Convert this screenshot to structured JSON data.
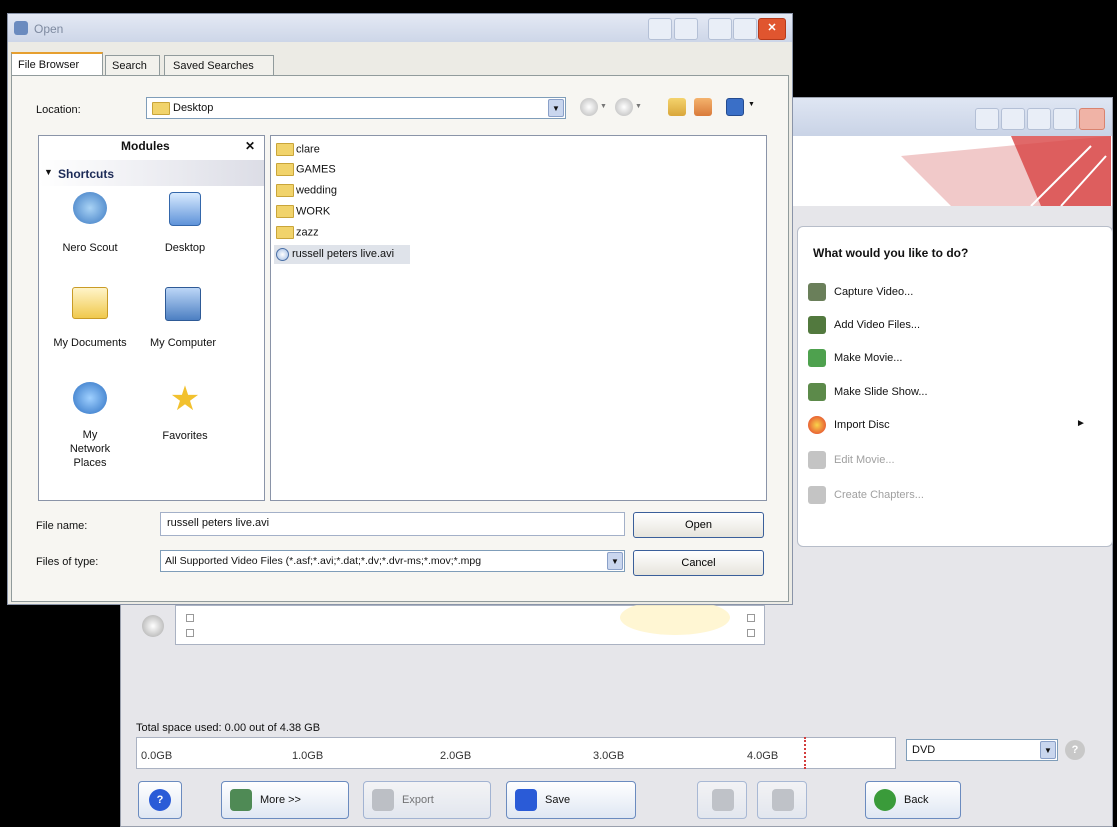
{
  "open_dialog": {
    "title": "Open",
    "tabs": [
      "File Browser",
      "Search",
      "Saved Searches"
    ],
    "location_label": "Location:",
    "location_value": "Desktop",
    "modules_title": "Modules",
    "shortcuts_label": "Shortcuts",
    "shortcuts": [
      {
        "label": "Nero Scout",
        "icon": "nero-scout-icon"
      },
      {
        "label": "Desktop",
        "icon": "desktop-icon"
      },
      {
        "label": "My Documents",
        "icon": "my-documents-icon"
      },
      {
        "label": "My Computer",
        "icon": "my-computer-icon"
      },
      {
        "label": "My Network Places",
        "icon": "network-places-icon"
      },
      {
        "label": "Favorites",
        "icon": "favorites-icon"
      }
    ],
    "files": [
      {
        "name": "clare",
        "type": "folder"
      },
      {
        "name": "GAMES",
        "type": "folder"
      },
      {
        "name": "wedding",
        "type": "folder"
      },
      {
        "name": "WORK",
        "type": "folder"
      },
      {
        "name": "zazz",
        "type": "folder"
      },
      {
        "name": "russell peters live.avi",
        "type": "video",
        "selected": true
      }
    ],
    "file_name_label": "File name:",
    "file_name_value": "russell peters live.avi",
    "file_type_label": "Files of type:",
    "file_type_value": "All Supported Video Files (*.asf;*.avi;*.dat;*.dv;*.dvr-ms;*.mov;*.mpg",
    "open_button": "Open",
    "cancel_button": "Cancel"
  },
  "main_window": {
    "panel_title": "What would you like to do?",
    "actions": [
      {
        "label": "Capture Video...",
        "enabled": true
      },
      {
        "label": "Add Video Files...",
        "enabled": true
      },
      {
        "label": "Make Movie...",
        "enabled": true
      },
      {
        "label": "Make Slide Show...",
        "enabled": true
      },
      {
        "label": "Import Disc",
        "enabled": true,
        "submenu": true
      },
      {
        "label": "Edit Movie...",
        "enabled": false
      },
      {
        "label": "Create Chapters...",
        "enabled": false
      }
    ],
    "space_used_text": "Total space used: 0.00 out of 4.38 GB",
    "ruler_labels": [
      "0.0GB",
      "1.0GB",
      "2.0GB",
      "3.0GB",
      "4.0GB"
    ],
    "disc_type": "DVD",
    "buttons": {
      "more": "More >>",
      "export": "Export",
      "save": "Save",
      "back": "Back"
    }
  },
  "colors": {
    "accent_blue": "#2a5bd7",
    "selection": "#dfe3ea",
    "close_red": "#e0552f"
  }
}
